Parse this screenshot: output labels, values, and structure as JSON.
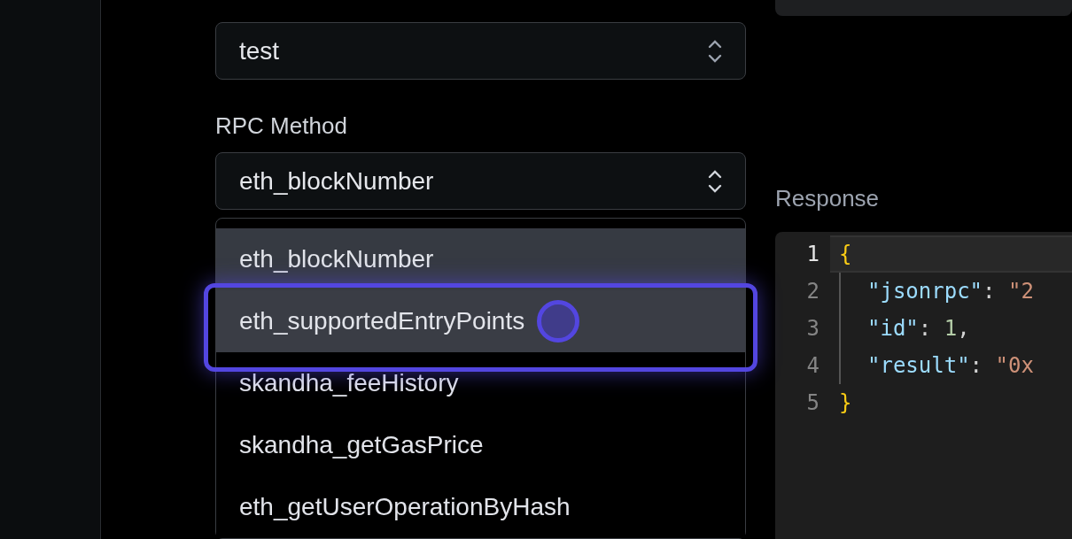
{
  "api_key_field": {
    "value": "test"
  },
  "rpc_method": {
    "label": "RPC Method",
    "value": "eth_blockNumber"
  },
  "options": [
    {
      "label": "eth_blockNumber",
      "selected": true,
      "highlighted": false
    },
    {
      "label": "eth_supportedEntryPoints",
      "selected": false,
      "highlighted": true
    },
    {
      "label": "skandha_feeHistory",
      "selected": false,
      "highlighted": false
    },
    {
      "label": "skandha_getGasPrice",
      "selected": false,
      "highlighted": false
    },
    {
      "label": "eth_getUserOperationByHash",
      "selected": false,
      "highlighted": false
    }
  ],
  "response": {
    "label": "Response",
    "lines": [
      {
        "number": "1",
        "current": true,
        "tokens": [
          {
            "kind": "brace",
            "text": "{"
          }
        ]
      },
      {
        "number": "2",
        "current": false,
        "tokens": [
          {
            "kind": "key",
            "text": "\"jsonrpc\""
          },
          {
            "kind": "punct",
            "text": ": "
          },
          {
            "kind": "string",
            "text": "\"2"
          }
        ]
      },
      {
        "number": "3",
        "current": false,
        "tokens": [
          {
            "kind": "key",
            "text": "\"id\""
          },
          {
            "kind": "punct",
            "text": ": "
          },
          {
            "kind": "number",
            "text": "1"
          },
          {
            "kind": "punct",
            "text": ","
          }
        ]
      },
      {
        "number": "4",
        "current": false,
        "tokens": [
          {
            "kind": "key",
            "text": "\"result\""
          },
          {
            "kind": "punct",
            "text": ": "
          },
          {
            "kind": "string",
            "text": "\"0x"
          }
        ]
      },
      {
        "number": "5",
        "current": false,
        "tokens": [
          {
            "kind": "brace",
            "text": "}"
          }
        ]
      }
    ]
  }
}
